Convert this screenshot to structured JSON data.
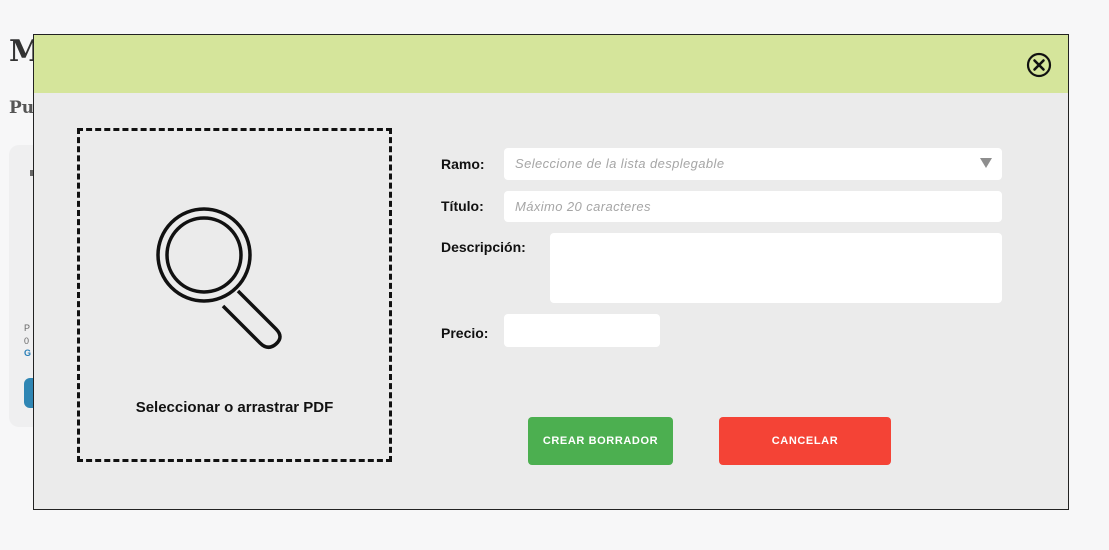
{
  "background": {
    "title": "M",
    "subtitle": "Pu",
    "card": {
      "line1": "P",
      "line2": "0",
      "line3": "G"
    }
  },
  "modal": {
    "header_color": "#d5e59b",
    "close_icon": "close-circle-icon",
    "dropzone": {
      "icon": "magnifier-icon",
      "label": "Seleccionar o arrastrar PDF"
    },
    "form": {
      "ramo": {
        "label": "Ramo:",
        "placeholder": "Seleccione de la lista desplegable"
      },
      "titulo": {
        "label": "Título:",
        "placeholder": "Máximo 20 caracteres",
        "value": ""
      },
      "descripcion": {
        "label": "Descripción:",
        "value": ""
      },
      "precio": {
        "label": "Precio:",
        "value": ""
      }
    },
    "buttons": {
      "create": {
        "label": "CREAR BORRADOR",
        "color": "#4caf50"
      },
      "cancel": {
        "label": "CANCELAR",
        "color": "#f44336"
      }
    }
  }
}
